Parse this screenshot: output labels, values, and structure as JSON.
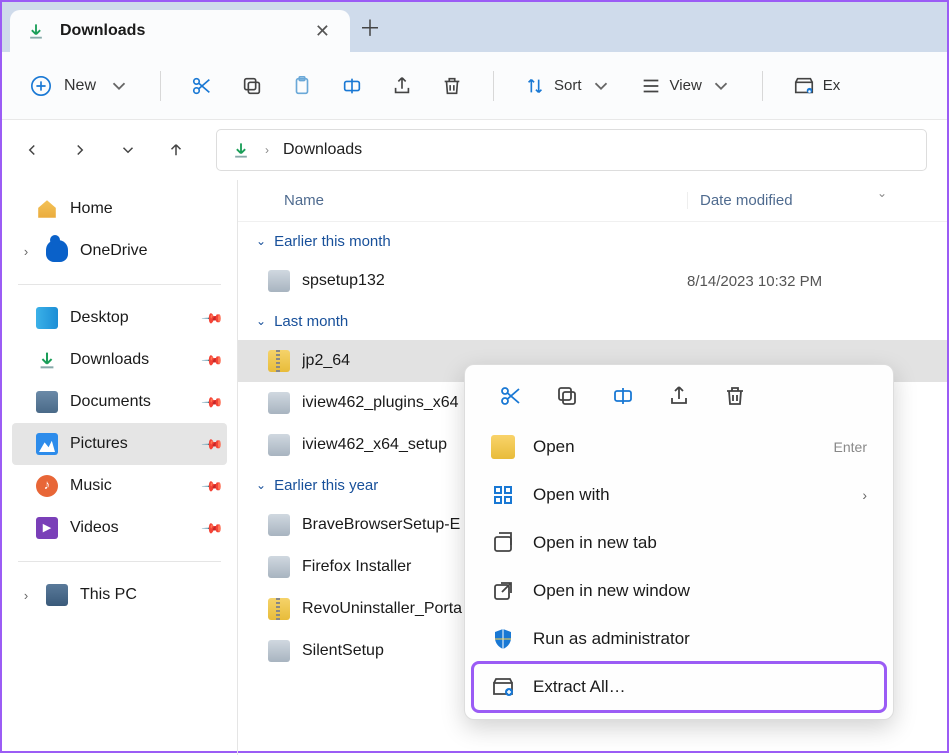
{
  "tab": {
    "title": "Downloads"
  },
  "toolbar": {
    "new": "New",
    "sort": "Sort",
    "view": "View",
    "extract": "Ex"
  },
  "breadcrumb": {
    "current": "Downloads"
  },
  "sidebar": {
    "home": "Home",
    "onedrive": "OneDrive",
    "desktop": "Desktop",
    "downloads": "Downloads",
    "documents": "Documents",
    "pictures": "Pictures",
    "music": "Music",
    "videos": "Videos",
    "thispc": "This PC"
  },
  "columns": {
    "name": "Name",
    "date": "Date modified"
  },
  "groups": [
    {
      "label": "Earlier this month",
      "files": [
        {
          "name": "spsetup132",
          "date": "8/14/2023 10:32 PM",
          "icon": "exe"
        }
      ]
    },
    {
      "label": "Last month",
      "files": [
        {
          "name": "jp2_64",
          "date": "",
          "icon": "zip",
          "selected": true
        },
        {
          "name": "iview462_plugins_x64",
          "date": "",
          "icon": "exe"
        },
        {
          "name": "iview462_x64_setup",
          "date": "",
          "icon": "exe"
        }
      ]
    },
    {
      "label": "Earlier this year",
      "files": [
        {
          "name": "BraveBrowserSetup-E",
          "date": "",
          "icon": "exe"
        },
        {
          "name": "Firefox Installer",
          "date": "",
          "icon": "exe"
        },
        {
          "name": "RevoUninstaller_Porta",
          "date": "",
          "icon": "zip"
        },
        {
          "name": "SilentSetup",
          "date": "",
          "icon": "exe"
        }
      ]
    }
  ],
  "contextMenu": {
    "open": "Open",
    "open_shortcut": "Enter",
    "open_with": "Open with",
    "open_new_tab": "Open in new tab",
    "open_new_window": "Open in new window",
    "run_admin": "Run as administrator",
    "extract_all": "Extract All…"
  }
}
